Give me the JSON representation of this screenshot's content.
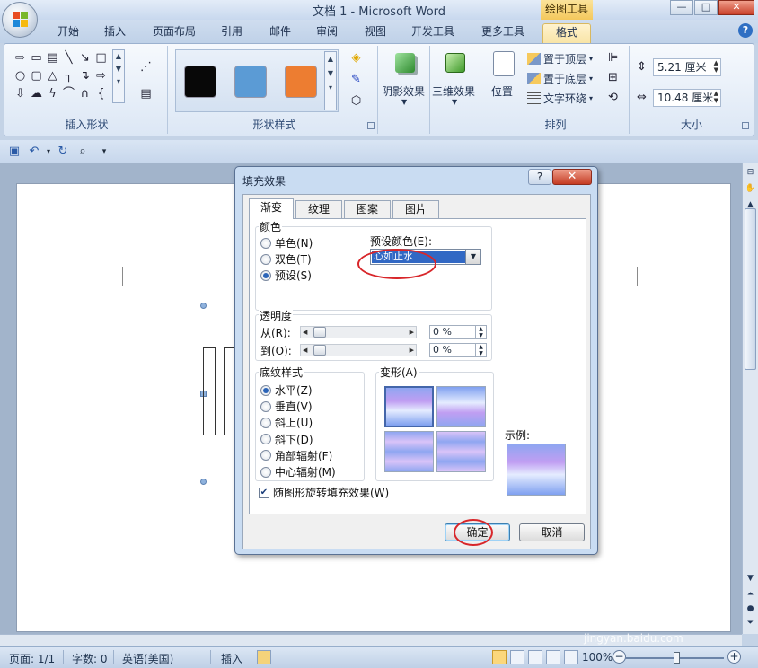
{
  "window": {
    "title": "文档 1 - Microsoft Word",
    "context_tab_title": "绘图工具",
    "minimize": "—",
    "restore": "□",
    "close": "✕",
    "help": "?"
  },
  "tabs": [
    "开始",
    "插入",
    "页面布局",
    "引用",
    "邮件",
    "审阅",
    "视图",
    "开发工具",
    "更多工具",
    "格式"
  ],
  "active_tab": "格式",
  "ribbon": {
    "groups": {
      "insert_shapes": "插入形状",
      "shape_styles": "形状样式",
      "arrange": "排列",
      "size": "大小"
    },
    "style_swatches": [
      "#080808",
      "#5b9bd5",
      "#ed7d31"
    ],
    "shadow_effects": "阴影效果",
    "threed_effects": "三维效果",
    "position": "位置",
    "bring_to_front": "置于顶层",
    "send_to_back": "置于底层",
    "text_wrapping": "文字环绕",
    "height_value": "5.21 厘米",
    "width_value": "10.48 厘米"
  },
  "dialog": {
    "title": "填充效果",
    "help": "?",
    "close": "✕",
    "tabs": [
      "渐变",
      "纹理",
      "图案",
      "图片"
    ],
    "active_tab": "渐变",
    "colors_section": "颜色",
    "color_options": [
      "单色(N)",
      "双色(T)",
      "预设(S)"
    ],
    "color_selected": "预设(S)",
    "preset_colors_label": "预设颜色(E):",
    "preset_value": "心如止水",
    "transparency_section": "透明度",
    "from_label": "从(R):",
    "to_label": "到(O):",
    "from_value": "0 %",
    "to_value": "0 %",
    "shading_styles_section": "底纹样式",
    "shading_options": [
      "水平(Z)",
      "垂直(V)",
      "斜上(U)",
      "斜下(D)",
      "角部辐射(F)",
      "中心辐射(M)"
    ],
    "shading_selected": "水平(Z)",
    "variants_label": "变形(A)",
    "sample_label": "示例:",
    "rotate_checkbox": "随图形旋转填充效果(W)",
    "rotate_checked": true,
    "ok": "确定",
    "cancel": "取消"
  },
  "statusbar": {
    "page": "页面: 1/1",
    "words": "字数: 0",
    "language": "英语(美国)",
    "insert_mode": "插入",
    "zoom": "100%",
    "zoom_minus": "−",
    "zoom_plus": "+"
  },
  "watermark": {
    "logo": "Baidu经验",
    "url": "jingyan.baidu.com"
  }
}
